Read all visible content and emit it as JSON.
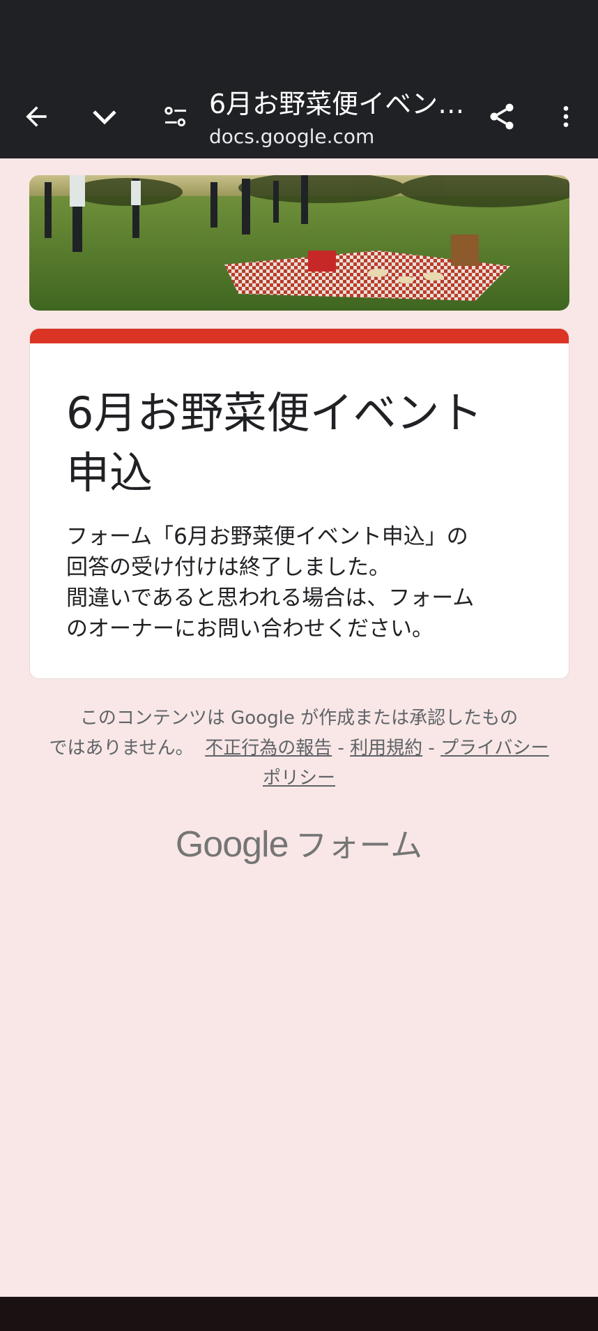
{
  "browser": {
    "title": "6月お野菜便イベント申込",
    "url": "docs.google.com"
  },
  "form": {
    "accent_color": "#db3425",
    "title_line1": "6月お野菜便イベント",
    "title_line2": "申込",
    "message_lines": [
      "フォーム「6月お野菜便イベント申込」の",
      "回答の受け付けは終了しました。",
      "間違いであると思われる場合は、フォーム",
      "のオーナーにお問い合わせください。"
    ]
  },
  "footer": {
    "disclaimer_1": "このコンテンツは Google が作成または承認したもの",
    "disclaimer_2": "ではありません。",
    "link_abuse": "不正行為の報告",
    "sep": "-",
    "link_terms": "利用規約",
    "link_privacy": "プライバシー ポリシー"
  },
  "brand": {
    "google": "Google",
    "forms": "フォーム"
  },
  "icons": [
    "back-arrow-icon",
    "chevron-down-icon",
    "tune-icon",
    "share-icon",
    "more-vert-icon"
  ]
}
